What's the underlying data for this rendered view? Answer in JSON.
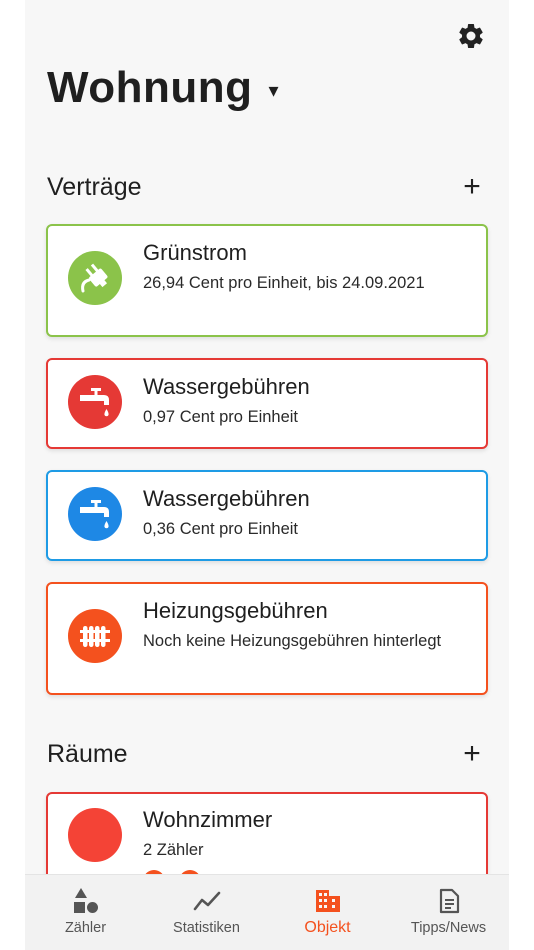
{
  "header": {
    "title": "Wohnung",
    "caret": "▾"
  },
  "sections": {
    "contracts": {
      "title": "Verträge",
      "add": "+"
    },
    "rooms": {
      "title": "Räume",
      "add": "+"
    }
  },
  "contracts": [
    {
      "name": "Grünstrom",
      "desc": "26,94 Cent pro Einheit, bis 24.09.2021",
      "color": "#8bc34a",
      "icon": "plug-icon"
    },
    {
      "name": "Wassergebühren",
      "desc": "0,97 Cent pro Einheit",
      "color": "#e53935",
      "icon": "water-tap-icon"
    },
    {
      "name": "Wassergebühren",
      "desc": "0,36 Cent pro Einheit",
      "color": "#1e88e5",
      "icon": "water-tap-icon"
    },
    {
      "name": "Heizungsgebühren",
      "desc": "Noch keine Heizungsgebühren hinterlegt",
      "color": "#f4511e",
      "icon": "radiator-icon"
    }
  ],
  "rooms": [
    {
      "name": "Wohnzimmer",
      "desc": "2 Zähler",
      "color": "#f44336",
      "border": "#e53935"
    }
  ],
  "tabs": [
    {
      "label": "Zähler",
      "icon": "shapes-icon",
      "active": false
    },
    {
      "label": "Statistiken",
      "icon": "trend-line-icon",
      "active": false
    },
    {
      "label": "Objekt",
      "icon": "building-icon",
      "active": true
    },
    {
      "label": "Tipps/News",
      "icon": "document-icon",
      "active": false
    }
  ],
  "colors": {
    "accent": "#f4511e",
    "background": "#f7f7f7"
  }
}
